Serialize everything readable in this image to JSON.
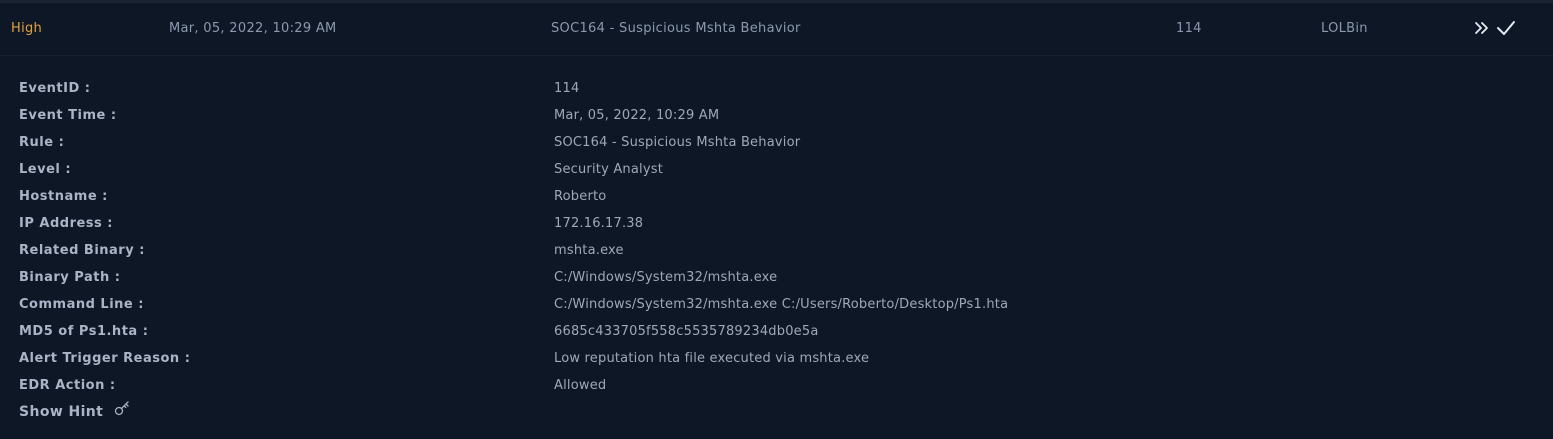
{
  "alert": {
    "severity": "High",
    "date": "Mar, 05, 2022, 10:29 AM",
    "rule": "SOC164 - Suspicious Mshta Behavior",
    "event_id": "114",
    "type": "LOLBin",
    "actions": [
      {
        "icon": "double-chevron-right-icon"
      },
      {
        "icon": "check-icon"
      }
    ]
  },
  "colors": {
    "background": "#0e1726",
    "severity_high": "#e2a03f",
    "label": "#a9b4c6",
    "value": "#a0a8b6"
  },
  "details": [
    {
      "label": "EventID :",
      "value": "114"
    },
    {
      "label": "Event Time :",
      "value": "Mar, 05, 2022, 10:29 AM"
    },
    {
      "label": "Rule :",
      "value": "SOC164 - Suspicious Mshta Behavior"
    },
    {
      "label": "Level :",
      "value": "Security Analyst"
    },
    {
      "label": "Hostname :",
      "value": "Roberto"
    },
    {
      "label": "IP Address :",
      "value": "172.16.17.38"
    },
    {
      "label": "Related Binary :",
      "value": "mshta.exe"
    },
    {
      "label": "Binary Path :",
      "value": "C:/Windows/System32/mshta.exe"
    },
    {
      "label": "Command Line :",
      "value": "C:/Windows/System32/mshta.exe C:/Users/Roberto/Desktop/Ps1.hta"
    },
    {
      "label": "MD5 of Ps1.hta :",
      "value": "6685c433705f558c5535789234db0e5a"
    },
    {
      "label": "Alert Trigger Reason :",
      "value": "Low reputation hta file executed via mshta.exe"
    },
    {
      "label": "EDR Action :",
      "value": "Allowed"
    }
  ],
  "hint": {
    "label": "Show Hint",
    "icon": "key-icon"
  }
}
